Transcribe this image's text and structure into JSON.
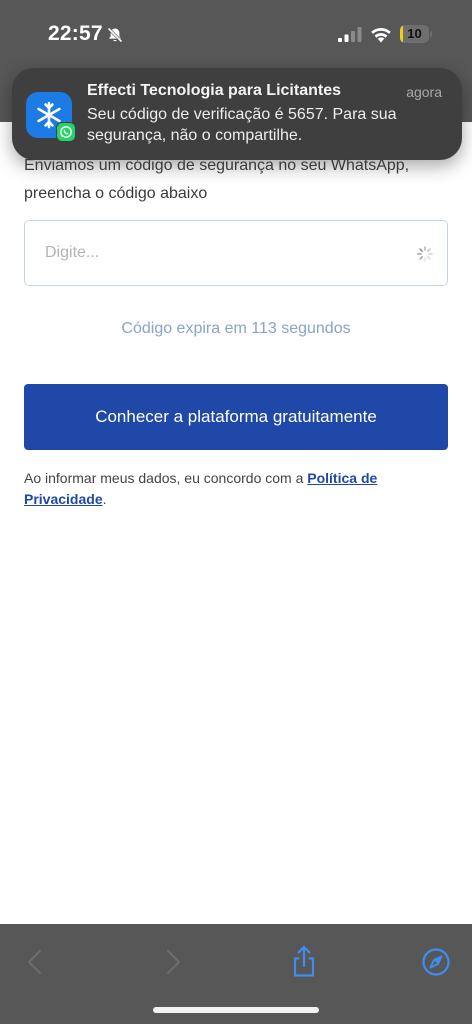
{
  "status_bar": {
    "time": "22:57",
    "battery_level": "10",
    "battery_fraction": 0.1,
    "icons": [
      "bell-slash-icon",
      "cellular-signal-icon",
      "wifi-icon",
      "battery-icon"
    ]
  },
  "notification": {
    "app_name": "Effecti Tecnologia para Licitantes",
    "time": "agora",
    "message": "Seu código de verificação é 5657. Para sua segurança, não o compartilhe.",
    "icons": [
      "effecti-app-icon",
      "whatsapp-badge-icon"
    ]
  },
  "page": {
    "intro": "Enviamos um código de segurança no seu WhatsApp, preencha o código abaixo",
    "code_input": {
      "placeholder": "Digite...",
      "value": ""
    },
    "expire_text": "Código expira em 113 segundos",
    "cta_label": "Conhecer a plataforma gratuitamente",
    "terms_text": "Ao informar meus dados, eu concordo com a ",
    "terms_link": "Política de Privacidade",
    "terms_end": "."
  },
  "toolbar": {
    "icons": [
      "back-chevron-icon",
      "forward-chevron-icon",
      "share-icon",
      "compass-icon"
    ]
  },
  "colors": {
    "primary_button": "#1f48a8",
    "expire_text": "#8aa3c9",
    "browser_chrome": "#575757",
    "toolbar_accent": "#3d8ef0"
  }
}
